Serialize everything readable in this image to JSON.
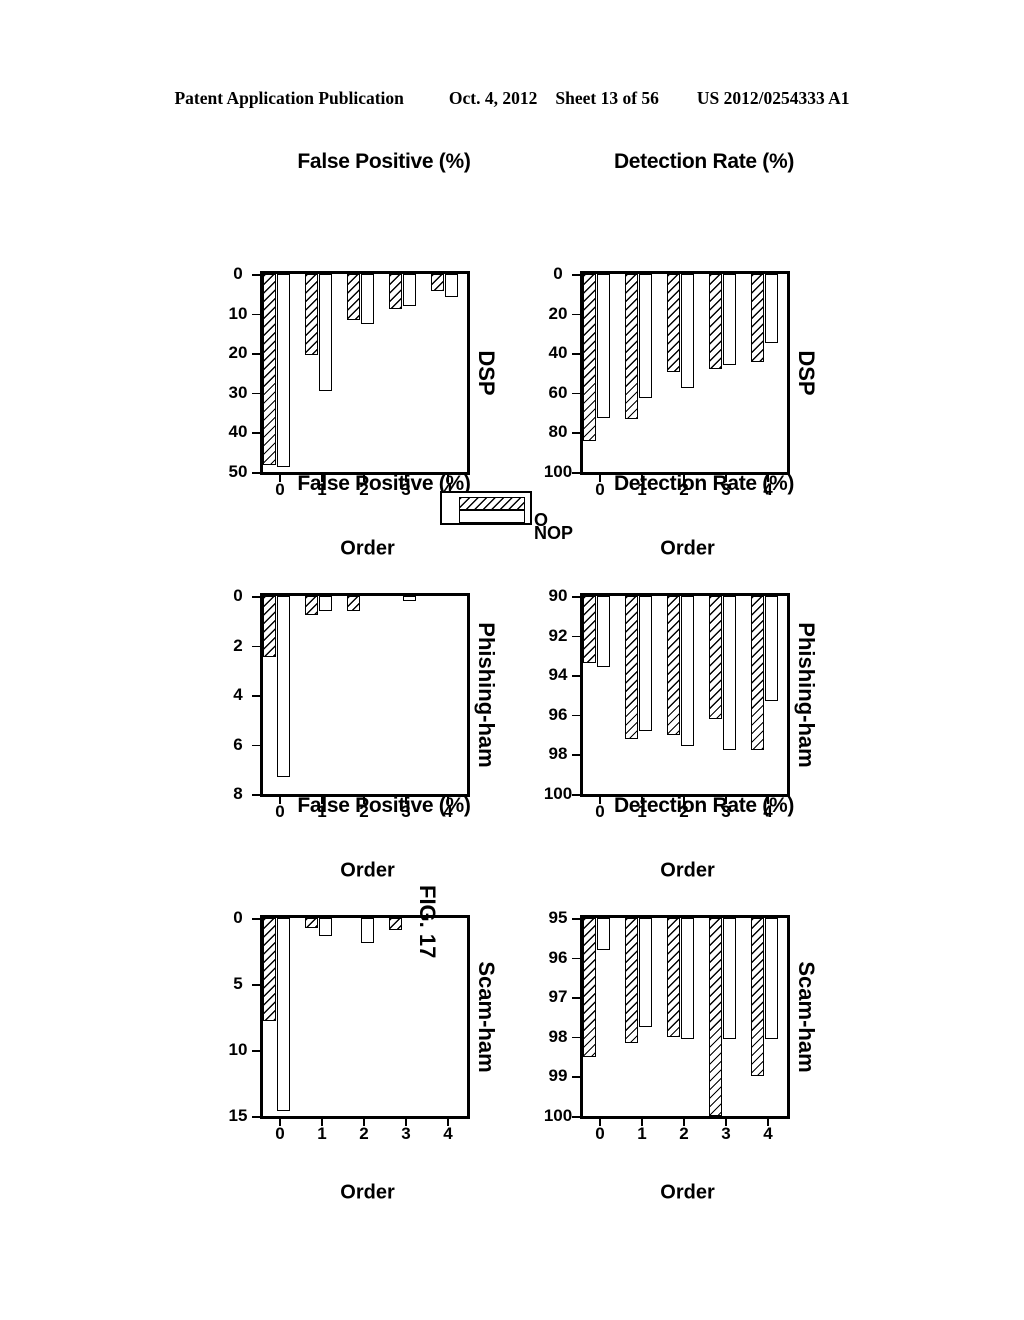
{
  "header": {
    "publication": "Patent Application Publication",
    "date": "Oct. 4, 2012",
    "sheet": "Sheet 13 of 56",
    "number": "US 2012/0254333 A1"
  },
  "figure": {
    "caption": "FIG. 17",
    "legend": {
      "series_a": "O",
      "series_b": "NOP"
    }
  },
  "chart_data": [
    {
      "id": "dsp-detection",
      "type": "bar",
      "title": "DSP",
      "orientation": "horizontal",
      "xlabel": "Order",
      "ylabel": "Detection Rate (%)",
      "categories": [
        "0",
        "1",
        "2",
        "3",
        "4"
      ],
      "ylim": [
        0,
        100
      ],
      "yticks": [
        0,
        20,
        40,
        60,
        80,
        100
      ],
      "grid": false,
      "series": [
        {
          "name": "O",
          "values": [
            84.4,
            73.3,
            49.7,
            48.0,
            44.4
          ]
        },
        {
          "name": "NOP",
          "values": [
            72.6,
            62.5,
            57.6,
            45.8,
            34.7
          ]
        }
      ]
    },
    {
      "id": "phishing-ham-detection",
      "type": "bar",
      "title": "Phishing-ham",
      "orientation": "horizontal",
      "xlabel": "Order",
      "ylabel": "Detection Rate (%)",
      "categories": [
        "0",
        "1",
        "2",
        "3",
        "4"
      ],
      "ylim": [
        90,
        100
      ],
      "yticks": [
        90,
        92,
        94,
        96,
        98,
        100
      ],
      "grid": false,
      "series": [
        {
          "name": "O",
          "values": [
            93.4,
            97.2,
            97.0,
            96.2,
            97.8
          ]
        },
        {
          "name": "NOP",
          "values": [
            93.6,
            96.8,
            97.6,
            97.8,
            95.3
          ]
        }
      ]
    },
    {
      "id": "scam-ham-detection",
      "type": "bar",
      "title": "Scam-ham",
      "orientation": "horizontal",
      "xlabel": "Order",
      "ylabel": "Detection Rate (%)",
      "categories": [
        "0",
        "1",
        "2",
        "3",
        "4"
      ],
      "ylim": [
        95,
        100
      ],
      "yticks": [
        95,
        96,
        97,
        98,
        99,
        100
      ],
      "grid": false,
      "series": [
        {
          "name": "O",
          "values": [
            98.5,
            98.15,
            98.0,
            100.0,
            99.0
          ]
        },
        {
          "name": "NOP",
          "values": [
            95.8,
            97.75,
            98.05,
            98.05,
            98.05
          ]
        }
      ]
    },
    {
      "id": "dsp-false-positive",
      "type": "bar",
      "title": "DSP",
      "orientation": "horizontal",
      "xlabel": "Order",
      "ylabel": "False Positive (%)",
      "categories": [
        "0",
        "1",
        "2",
        "3",
        "4"
      ],
      "ylim": [
        0,
        50
      ],
      "yticks": [
        0,
        10,
        20,
        30,
        40,
        50
      ],
      "grid": false,
      "series": [
        {
          "name": "O",
          "values": [
            48.3,
            20.5,
            11.6,
            8.9,
            4.2
          ]
        },
        {
          "name": "NOP",
          "values": [
            48.8,
            29.5,
            12.6,
            8.0,
            5.8
          ]
        }
      ]
    },
    {
      "id": "phishing-ham-false-positive",
      "type": "bar",
      "title": "Phishing-ham",
      "orientation": "horizontal",
      "xlabel": "Order",
      "ylabel": "False Positive (%)",
      "categories": [
        "0",
        "1",
        "2",
        "3",
        "4"
      ],
      "ylim": [
        0,
        8
      ],
      "yticks": [
        0,
        2,
        4,
        6,
        8
      ],
      "grid": false,
      "series": [
        {
          "name": "O",
          "values": [
            2.45,
            0.75,
            0.62,
            0.0,
            0.0
          ]
        },
        {
          "name": "NOP",
          "values": [
            7.3,
            0.62,
            0.0,
            0.2,
            0.0
          ]
        }
      ]
    },
    {
      "id": "scam-ham-false-positive",
      "type": "bar",
      "title": "Scam-ham",
      "orientation": "horizontal",
      "xlabel": "Order",
      "ylabel": "False Positive (%)",
      "categories": [
        "0",
        "1",
        "2",
        "3",
        "4"
      ],
      "ylim": [
        0,
        15
      ],
      "yticks": [
        0,
        5,
        10,
        15
      ],
      "grid": false,
      "series": [
        {
          "name": "O",
          "values": [
            7.8,
            0.75,
            0.0,
            0.9,
            0.0
          ]
        },
        {
          "name": "NOP",
          "values": [
            14.6,
            1.35,
            1.9,
            0.0,
            0.0
          ]
        }
      ]
    }
  ]
}
